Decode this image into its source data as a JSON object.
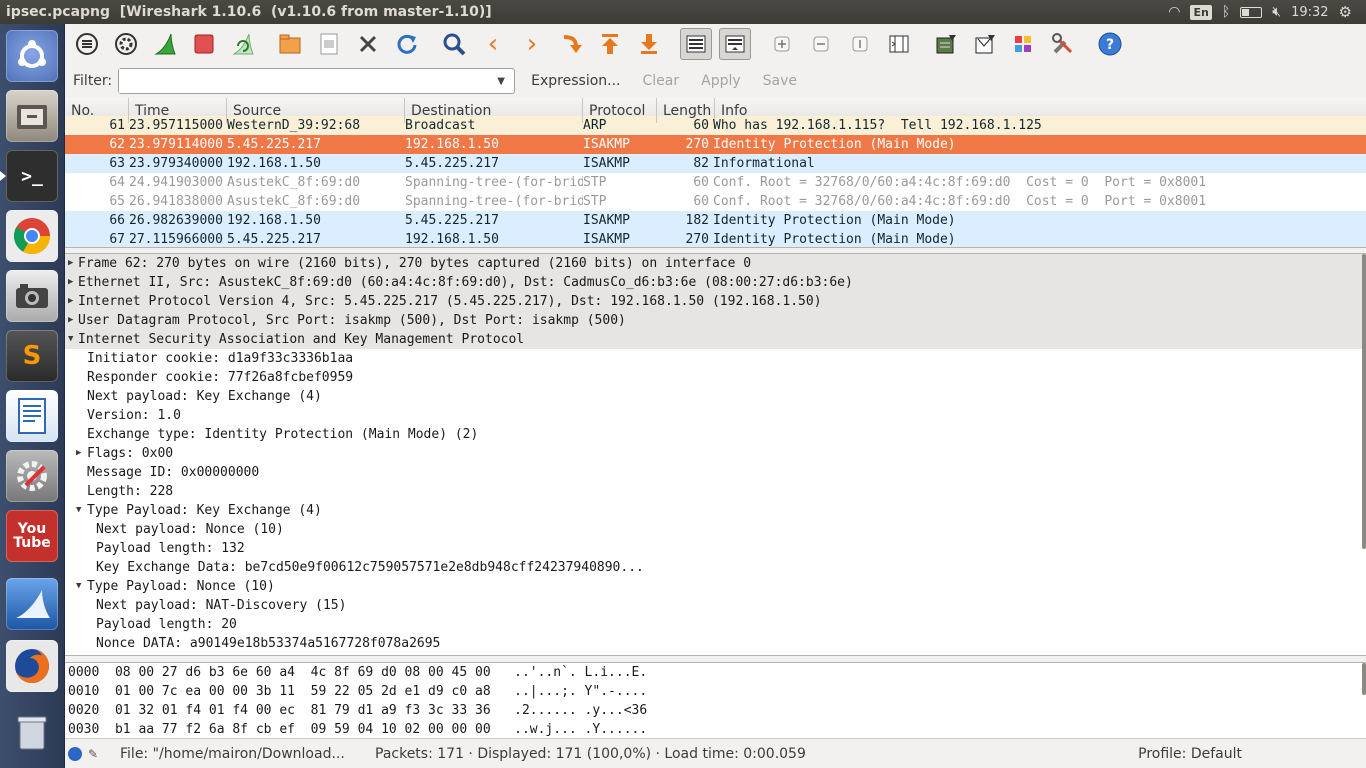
{
  "window": {
    "file": "ipsec.pcapng",
    "title": "[Wireshark 1.10.6  (v1.10.6 from master-1.10)]"
  },
  "panel": {
    "keyboard": "En",
    "clock": "19:32"
  },
  "launcher": [
    {
      "name": "ubuntu-dash",
      "label": "",
      "color": "#6b8bd0"
    },
    {
      "name": "files",
      "label": "",
      "color": "#b9b2a6"
    },
    {
      "name": "terminal",
      "label": ">_",
      "color": "#2b2b2b"
    },
    {
      "name": "chrome",
      "label": "",
      "color": "#ffffff"
    },
    {
      "name": "shotwell",
      "label": "",
      "color": "#cfcfcf"
    },
    {
      "name": "sublime",
      "label": "S",
      "color": "#4a4a4a"
    },
    {
      "name": "writer",
      "label": "",
      "color": "#3a76c3"
    },
    {
      "name": "settings",
      "label": "",
      "color": "#8e8e8e"
    },
    {
      "name": "youtube",
      "label": "You Tube",
      "color": "#c4302b"
    },
    {
      "name": "wireshark",
      "label": "",
      "color": "#2c73c8"
    },
    {
      "name": "firefox",
      "label": "",
      "color": "#e86e1f"
    },
    {
      "name": "trash",
      "label": "",
      "color": "#7d8a9c"
    }
  ],
  "filter": {
    "label": "Filter:",
    "value": "",
    "expression": "Expression...",
    "clear": "Clear",
    "apply": "Apply",
    "save": "Save"
  },
  "packet_list": {
    "columns": [
      "No.",
      "Time",
      "Source",
      "Destination",
      "Protocol",
      "Length",
      "Info"
    ],
    "rows": [
      {
        "no": "61",
        "time": "23.957115000",
        "src": "WesternD_39:92:68",
        "dst": "Broadcast",
        "proto": "ARP",
        "len": "60",
        "info": "Who has 192.168.1.115?  Tell 192.168.1.125",
        "style": "arp"
      },
      {
        "no": "62",
        "time": "23.979114000",
        "src": "5.45.225.217",
        "dst": "192.168.1.50",
        "proto": "ISAKMP",
        "len": "270",
        "info": "Identity Protection (Main Mode)",
        "style": "sel"
      },
      {
        "no": "63",
        "time": "23.979340000",
        "src": "192.168.1.50",
        "dst": "5.45.225.217",
        "proto": "ISAKMP",
        "len": "82",
        "info": "Informational",
        "style": "udp"
      },
      {
        "no": "64",
        "time": "24.941903000",
        "src": "AsustekC_8f:69:d0",
        "dst": "Spanning-tree-(for-bridges)",
        "proto": "STP",
        "len": "60",
        "info": "Conf. Root = 32768/0/60:a4:4c:8f:69:d0  Cost = 0  Port = 0x8001",
        "style": "stp"
      },
      {
        "no": "65",
        "time": "26.941838000",
        "src": "AsustekC_8f:69:d0",
        "dst": "Spanning-tree-(for-bridges)",
        "proto": "STP",
        "len": "60",
        "info": "Conf. Root = 32768/0/60:a4:4c:8f:69:d0  Cost = 0  Port = 0x8001",
        "style": "stp"
      },
      {
        "no": "66",
        "time": "26.982639000",
        "src": "192.168.1.50",
        "dst": "5.45.225.217",
        "proto": "ISAKMP",
        "len": "182",
        "info": "Identity Protection (Main Mode)",
        "style": "udp"
      },
      {
        "no": "67",
        "time": "27.115966000",
        "src": "5.45.225.217",
        "dst": "192.168.1.50",
        "proto": "ISAKMP",
        "len": "270",
        "info": "Identity Protection (Main Mode)",
        "style": "udp"
      }
    ]
  },
  "details": [
    {
      "lvl": 0,
      "exp": "c",
      "text": "Frame 62: 270 bytes on wire (2160 bits), 270 bytes captured (2160 bits) on interface 0"
    },
    {
      "lvl": 0,
      "exp": "c",
      "text": "Ethernet II, Src: AsustekC_8f:69:d0 (60:a4:4c:8f:69:d0), Dst: CadmusCo_d6:b3:6e (08:00:27:d6:b3:6e)"
    },
    {
      "lvl": 0,
      "exp": "c",
      "text": "Internet Protocol Version 4, Src: 5.45.225.217 (5.45.225.217), Dst: 192.168.1.50 (192.168.1.50)"
    },
    {
      "lvl": 0,
      "exp": "c",
      "text": "User Datagram Protocol, Src Port: isakmp (500), Dst Port: isakmp (500)"
    },
    {
      "lvl": 0,
      "exp": "o",
      "text": "Internet Security Association and Key Management Protocol"
    },
    {
      "lvl": 1,
      "exp": "",
      "text": "Initiator cookie: d1a9f33c3336b1aa"
    },
    {
      "lvl": 1,
      "exp": "",
      "text": "Responder cookie: 77f26a8fcbef0959"
    },
    {
      "lvl": 1,
      "exp": "",
      "text": "Next payload: Key Exchange (4)"
    },
    {
      "lvl": 1,
      "exp": "",
      "text": "Version: 1.0"
    },
    {
      "lvl": 1,
      "exp": "",
      "text": "Exchange type: Identity Protection (Main Mode) (2)"
    },
    {
      "lvl": 1,
      "exp": "c",
      "text": "Flags: 0x00"
    },
    {
      "lvl": 1,
      "exp": "",
      "text": "Message ID: 0x00000000"
    },
    {
      "lvl": 1,
      "exp": "",
      "text": "Length: 228"
    },
    {
      "lvl": 1,
      "exp": "o",
      "text": "Type Payload: Key Exchange (4)"
    },
    {
      "lvl": 2,
      "exp": "",
      "text": "Next payload: Nonce (10)"
    },
    {
      "lvl": 2,
      "exp": "",
      "text": "Payload length: 132"
    },
    {
      "lvl": 2,
      "exp": "",
      "text": "Key Exchange Data: be7cd50e9f00612c759057571e2e8db948cff24237940890..."
    },
    {
      "lvl": 1,
      "exp": "o",
      "text": "Type Payload: Nonce (10)"
    },
    {
      "lvl": 2,
      "exp": "",
      "text": "Next payload: NAT-Discovery (15)"
    },
    {
      "lvl": 2,
      "exp": "",
      "text": "Payload length: 20"
    },
    {
      "lvl": 2,
      "exp": "",
      "text": "Nonce DATA: a90149e18b53374a5167728f078a2695"
    }
  ],
  "bytes": [
    "0000  08 00 27 d6 b3 6e 60 a4  4c 8f 69 d0 08 00 45 00   ..'..n`. L.i...E.",
    "0010  01 00 7c ea 00 00 3b 11  59 22 05 2d e1 d9 c0 a8   ..|...;. Y\".-....",
    "0020  01 32 01 f4 01 f4 00 ec  81 79 d1 a9 f3 3c 33 36   .2...... .y...<36",
    "0030  b1 aa 77 f2 6a 8f cb ef  09 59 04 10 02 00 00 00   ..w.j... .Y......"
  ],
  "status": {
    "file": "File: \"/home/mairon/Download...",
    "packets": "Packets: 171 · Displayed: 171 (100,0%) · Load time: 0:00.059",
    "profile": "Profile: Default"
  }
}
